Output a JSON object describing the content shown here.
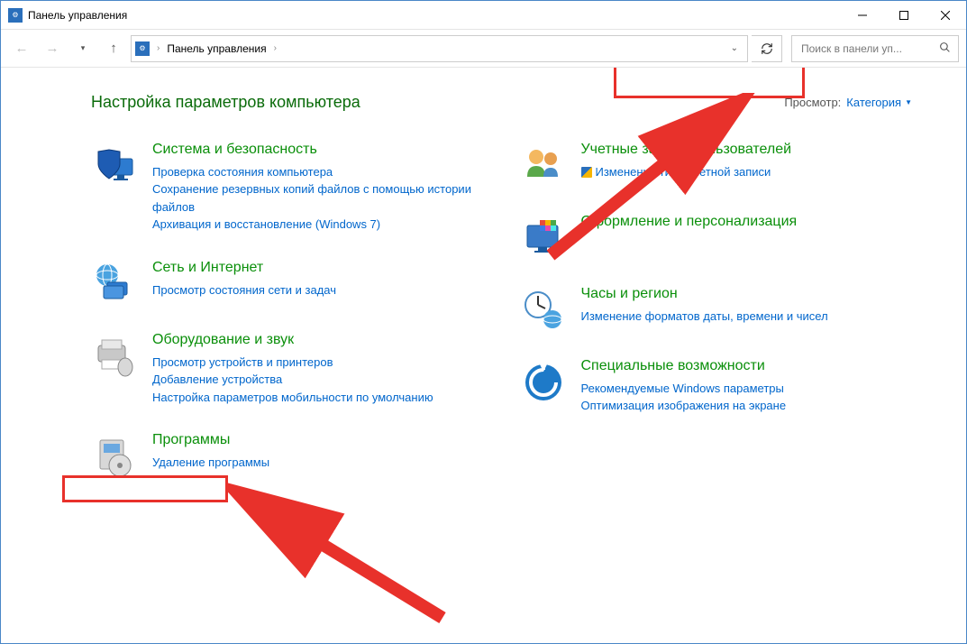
{
  "window": {
    "title": "Панель управления"
  },
  "nav": {
    "breadcrumb": "Панель управления",
    "search_placeholder": "Поиск в панели уп..."
  },
  "header": {
    "title": "Настройка параметров компьютера",
    "view_label": "Просмотр:",
    "view_value": "Категория"
  },
  "cats": {
    "system": {
      "title": "Система и безопасность",
      "l1": "Проверка состояния компьютера",
      "l2": "Сохранение резервных копий файлов с помощью истории файлов",
      "l3": "Архивация и восстановление (Windows 7)"
    },
    "network": {
      "title": "Сеть и Интернет",
      "l1": "Просмотр состояния сети и задач"
    },
    "hardware": {
      "title": "Оборудование и звук",
      "l1": "Просмотр устройств и принтеров",
      "l2": "Добавление устройства",
      "l3": "Настройка параметров мобильности по умолчанию"
    },
    "programs": {
      "title": "Программы",
      "l1": "Удаление программы"
    },
    "users": {
      "title": "Учетные записи пользователей",
      "l1": "Изменение типа учетной записи"
    },
    "appearance": {
      "title": "Оформление и персонализация"
    },
    "clock": {
      "title": "Часы и регион",
      "l1": "Изменение форматов даты, времени и чисел"
    },
    "ease": {
      "title": "Специальные возможности",
      "l1": "Рекомендуемые Windows параметры",
      "l2": "Оптимизация изображения на экране"
    }
  }
}
